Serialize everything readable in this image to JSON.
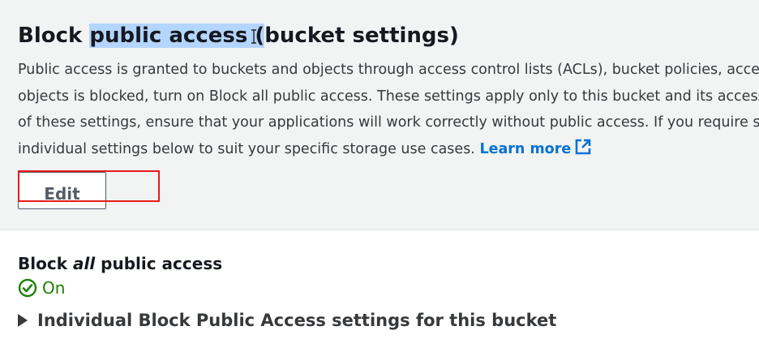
{
  "section": {
    "title_before": "Block ",
    "title_selected": "public access (",
    "title_after": "ucket settings)",
    "description_lines": [
      "Public access is granted to buckets and objects through access control lists (ACLs), bucket policies, access",
      "objects is blocked, turn on Block all public access. These settings apply only to this bucket and its access p",
      "of these settings, ensure that your applications will work correctly without public access. If you require so"
    ],
    "description_last_line": "individual settings below to suit your specific storage use cases. ",
    "learn_more": "Learn more",
    "edit_label": "Edit"
  },
  "status": {
    "label_prefix": "Block ",
    "label_emphasis": "all",
    "label_suffix": " public access",
    "value": "On",
    "expander_label": "Individual Block Public Access settings for this bucket"
  },
  "icons": {
    "external_link": "external-link-icon",
    "status_check": "check-circle-icon",
    "expand": "caret-right-icon",
    "cursor": "text-cursor-icon"
  },
  "colors": {
    "link": "#0972d3",
    "success": "#1d8102",
    "highlight": "#e81a1a",
    "selection": "#b4d5fe",
    "panel_bg": "#f2f3f3"
  }
}
